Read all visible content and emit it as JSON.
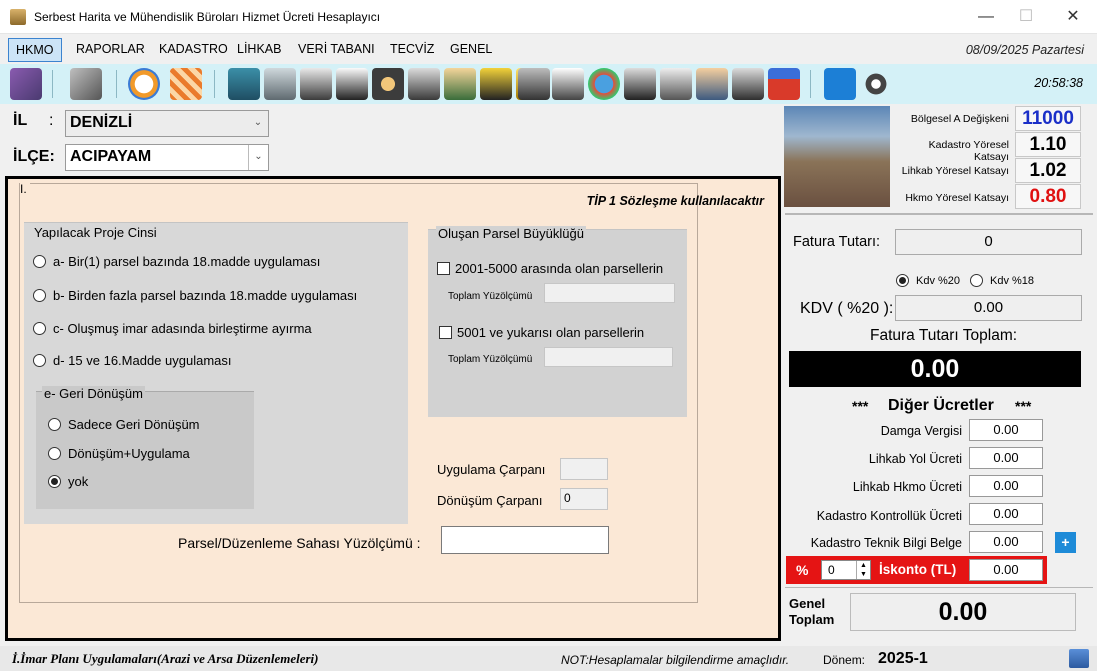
{
  "window": {
    "title": "Serbest Harita ve Mühendislik Büroları Hizmet Ücreti Hesaplayıcı",
    "minimize_glyph": "—",
    "maximize_glyph": "☐",
    "close_glyph": "✕"
  },
  "menu": {
    "items": [
      "HKMO",
      "RAPORLAR",
      "KADASTRO",
      "LİHKAB",
      "VERİ TABANI",
      "TECVİZ",
      "GENEL"
    ],
    "active": "HKMO",
    "date": "08/09/2025 Pazartesi"
  },
  "toolbar": {
    "icons": [
      "database-icon",
      "calculator-icon",
      "certificate-icon",
      "map-grid-icon",
      "chart-edit-icon",
      "puzzle-icon",
      "map-board-icon",
      "floor-plan-icon",
      "settings-hand-icon",
      "survey-truck-icon",
      "mining-icon",
      "total-station-icon",
      "ruler-icon",
      "power-tower-icon",
      "parcel-map-icon",
      "globe-icon",
      "building-map-icon",
      "checklist-icon",
      "engineer-desk-icon",
      "team-icon",
      "parking-car-icon",
      "export-icon",
      "gears-icon"
    ],
    "time": "20:58:38"
  },
  "location": {
    "il_label": "İL",
    "il_colon": ":",
    "il_value": "DENİZLİ",
    "ilce_label": "İLÇE:",
    "ilce_value": "ACIPAYAM"
  },
  "main": {
    "group_label": "I.",
    "tip_text": "TİP 1 Sözleşme kullanılacaktır",
    "project_type": {
      "title": "Yapılacak Proje Cinsi",
      "options": [
        "a- Bir(1) parsel bazında 18.madde uygulaması",
        "b- Birden fazla parsel bazında 18.madde uygulaması",
        "c- Oluşmuş imar adasında birleştirme ayırma",
        "d- 15 ve 16.Madde uygulaması"
      ]
    },
    "geri_donusum": {
      "title": "e- Geri Dönüşüm",
      "options": [
        "Sadece Geri Dönüşüm",
        "Dönüşüm+Uygulama",
        "yok"
      ],
      "selected": "yok"
    },
    "parsel_size": {
      "title": "Oluşan Parsel Büyüklüğü",
      "option1": "2001-5000 arasında olan parsellerin",
      "option2": "5001 ve yukarısı olan parsellerin",
      "area_label": "Toplam Yüzölçümü",
      "area1_value": "",
      "area2_value": ""
    },
    "uygulama_carpani_label": "Uygulama Çarpanı",
    "uygulama_carpani_value": "",
    "donusum_carpani_label": "Dönüşüm Çarpanı",
    "donusum_carpani_value": "0",
    "yuzolcum_label": "Parsel/Düzenleme Sahası Yüzölçümü :",
    "yuzolcum_value": ""
  },
  "rates": [
    {
      "label": "Bölgesel A Değişkeni",
      "value": "11000",
      "color": "#1a2fc8"
    },
    {
      "label": "Kadastro Yöresel Katsayı",
      "value": "1.10",
      "color": "#000000"
    },
    {
      "label": "Lihkab Yöresel Katsayı",
      "value": "1.02",
      "color": "#000000"
    },
    {
      "label": "Hkmo Yöresel Katsayı",
      "value": "0.80",
      "color": "#e01010"
    }
  ],
  "invoice": {
    "fatura_label": "Fatura Tutarı:",
    "fatura_value": "0",
    "kdv20_label": "Kdv %20",
    "kdv18_label": "Kdv %18",
    "kdv_selected": "Kdv %20",
    "kdv_label": "KDV ( %20 ):",
    "kdv_value": "0.00",
    "toplam_label": "Fatura Tutarı Toplam:",
    "toplam_value": "0.00"
  },
  "fees": {
    "title_stars_left": "***",
    "title": "Diğer Ücretler",
    "title_stars_right": "***",
    "items": [
      {
        "label": "Damga Vergisi",
        "value": "0.00"
      },
      {
        "label": "Lihkab Yol Ücreti",
        "value": "0.00"
      },
      {
        "label": "Lihkab Hkmo Ücreti",
        "value": "0.00"
      },
      {
        "label": "Kadastro Kontrollük Ücreti",
        "value": "0.00"
      },
      {
        "label": "Kadastro Teknik Bilgi Belge",
        "value": "0.00"
      }
    ],
    "plus_label": "+",
    "iskonto": {
      "percent_label": "%",
      "percent_value": "0",
      "label": "İskonto (TL)",
      "value": "0.00"
    },
    "genel_label_1": "Genel",
    "genel_label_2": "Toplam",
    "genel_value": "0.00"
  },
  "status": {
    "section": "İ.İmar Planı Uygulamaları(Arazi ve Arsa Düzenlemeleri)",
    "note": "NOT:Hesaplamalar bilgilendirme amaçlıdır.",
    "donem_label": "Dönem:",
    "donem_value": "2025-1"
  }
}
